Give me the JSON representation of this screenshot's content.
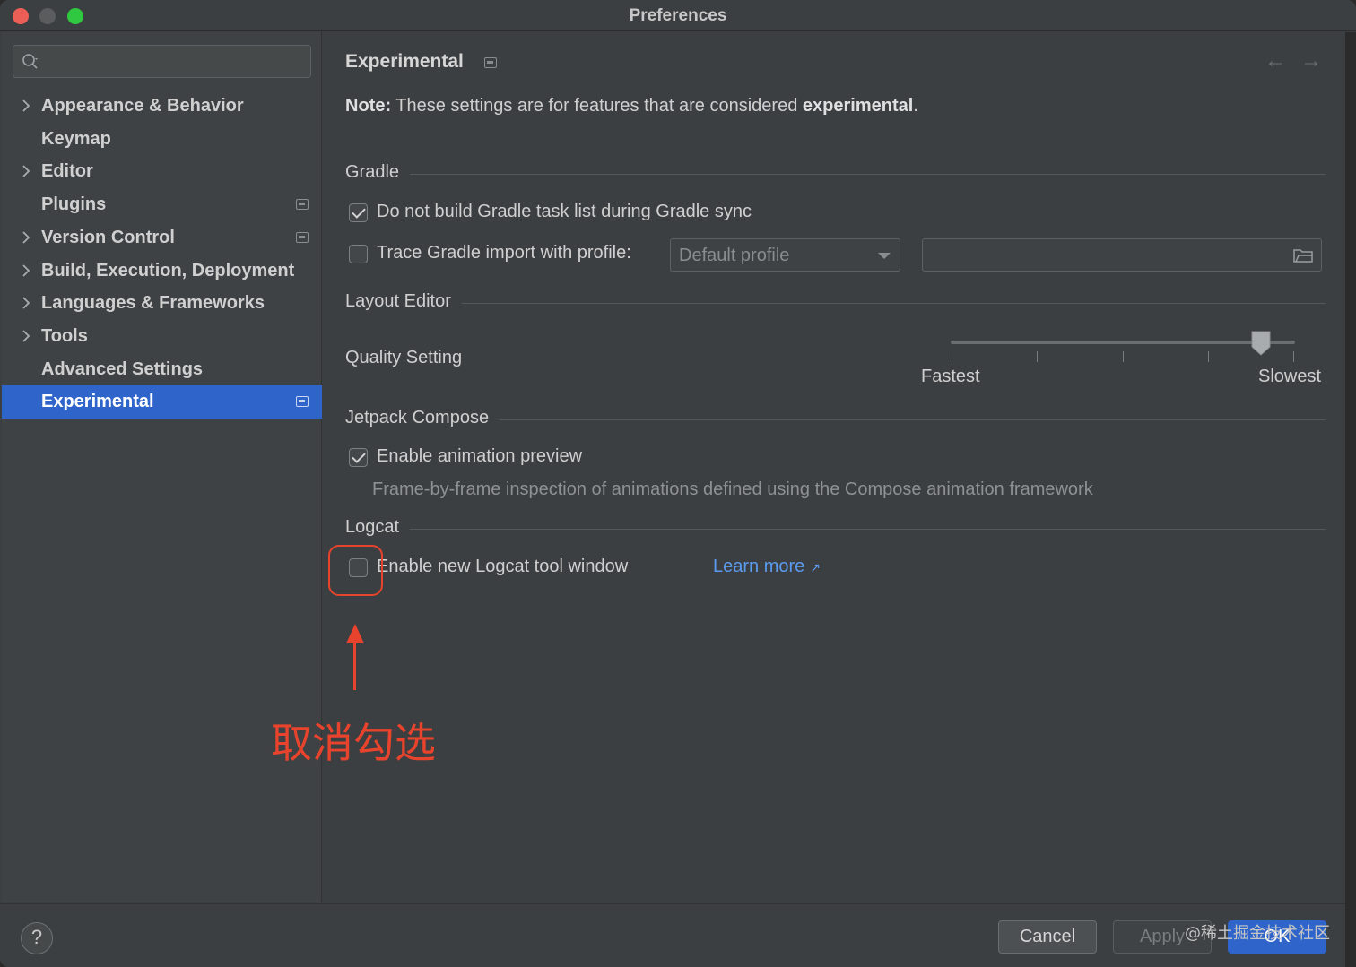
{
  "window": {
    "title": "Preferences"
  },
  "search": {
    "placeholder": ""
  },
  "sidebar": {
    "items": [
      {
        "label": "Appearance & Behavior",
        "expandable": true,
        "badge": false,
        "selected": false
      },
      {
        "label": "Keymap",
        "expandable": false,
        "badge": false,
        "selected": false
      },
      {
        "label": "Editor",
        "expandable": true,
        "badge": false,
        "selected": false
      },
      {
        "label": "Plugins",
        "expandable": false,
        "badge": true,
        "selected": false
      },
      {
        "label": "Version Control",
        "expandable": true,
        "badge": true,
        "selected": false
      },
      {
        "label": "Build, Execution, Deployment",
        "expandable": true,
        "badge": false,
        "selected": false
      },
      {
        "label": "Languages & Frameworks",
        "expandable": true,
        "badge": false,
        "selected": false
      },
      {
        "label": "Tools",
        "expandable": true,
        "badge": false,
        "selected": false
      },
      {
        "label": "Advanced Settings",
        "expandable": false,
        "badge": false,
        "selected": false
      },
      {
        "label": "Experimental",
        "expandable": false,
        "badge": true,
        "selected": true
      }
    ]
  },
  "main": {
    "title": "Experimental",
    "note_prefix": "Note:",
    "note_text": " These settings are for features that are considered ",
    "note_emphasis": "experimental",
    "note_suffix": ".",
    "gradle": {
      "section": "Gradle",
      "no_task_list": {
        "label": "Do not build Gradle task list during Gradle sync",
        "checked": true
      },
      "trace_import": {
        "label": "Trace Gradle import with profile:",
        "checked": false
      },
      "profile_value": "Default profile",
      "profile_path": ""
    },
    "layout_editor": {
      "section": "Layout Editor",
      "quality_label": "Quality Setting",
      "slider_min_label": "Fastest",
      "slider_max_label": "Slowest",
      "slider_value_fraction": 0.9
    },
    "compose": {
      "section": "Jetpack Compose",
      "animation_preview": {
        "label": "Enable animation preview",
        "checked": true
      },
      "description": "Frame-by-frame inspection of animations defined using the Compose animation framework"
    },
    "logcat": {
      "section": "Logcat",
      "new_window": {
        "label": "Enable new Logcat tool window",
        "checked": false
      },
      "learn_more": "Learn more",
      "learn_more_icon": "↗"
    }
  },
  "annotation": {
    "text": "取消勾选",
    "color": "#e8432c"
  },
  "footer": {
    "help_label": "?",
    "cancel_label": "Cancel",
    "apply_label": "Apply",
    "ok_label": "OK",
    "watermark": "@稀土掘金技术社区"
  },
  "colors": {
    "accent": "#2f65ca",
    "link": "#5a9bf0",
    "background": "#3c3f41"
  }
}
